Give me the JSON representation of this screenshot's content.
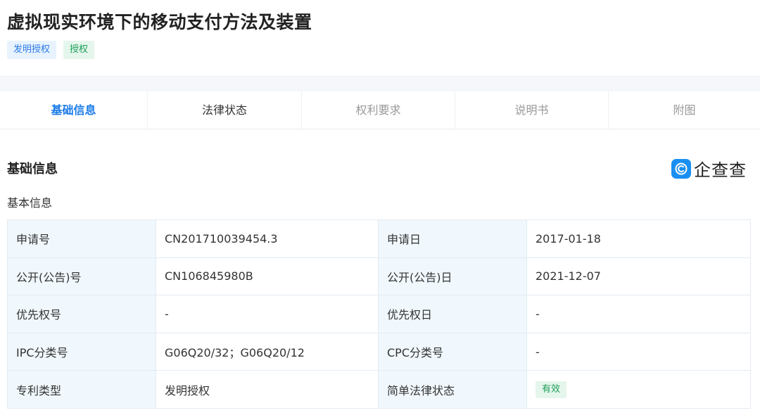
{
  "header": {
    "title": "虚拟现实环境下的移动支付方法及装置",
    "tags": [
      "发明授权",
      "授权"
    ]
  },
  "tabs": [
    "基础信息",
    "法律状态",
    "权利要求",
    "说明书",
    "附图"
  ],
  "section": {
    "title": "基础信息",
    "brand": "企查查",
    "subtitle": "基本信息"
  },
  "table": {
    "rows": [
      {
        "l1": "申请号",
        "v1": "CN201710039454.3",
        "l2": "申请日",
        "v2": "2017-01-18"
      },
      {
        "l1": "公开(公告)号",
        "v1": "CN106845980B",
        "l2": "公开(公告)日",
        "v2": "2021-12-07"
      },
      {
        "l1": "优先权号",
        "v1": "-",
        "l2": "优先权日",
        "v2": "-"
      },
      {
        "l1": "IPC分类号",
        "v1": "G06Q20/32；G06Q20/12",
        "l2": "CPC分类号",
        "v2": "-"
      },
      {
        "l1": "专利类型",
        "v1": "发明授权",
        "l2": "简单法律状态",
        "v2": "有效"
      }
    ]
  },
  "colors": {
    "accent": "#1a7ae8",
    "tag_blue_bg": "#e8f3ff",
    "tag_green_bg": "#e5f6ec",
    "label_cell_bg": "#f1f8fd",
    "brand_icon": "#1a8ff2"
  },
  "icons": {
    "brand": "qichacha-logo-icon"
  }
}
